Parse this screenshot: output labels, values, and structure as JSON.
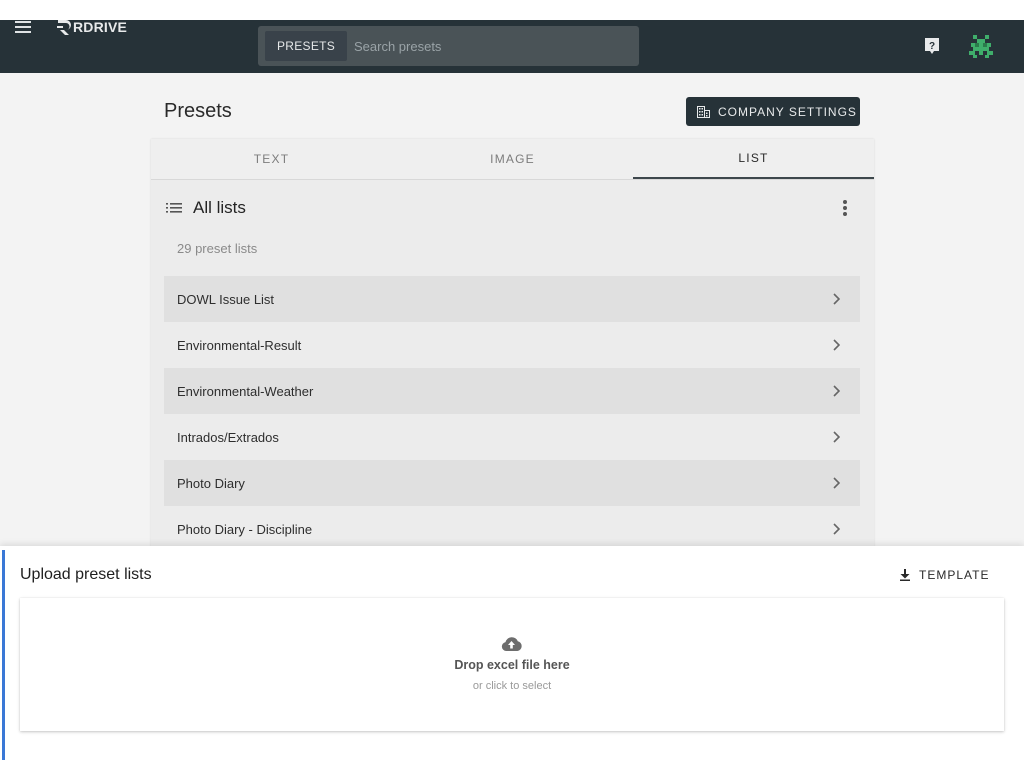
{
  "app": {
    "brand": "RDRIVE",
    "colors": {
      "appbar": "#263238",
      "accent_bar": "#3a78d6",
      "avatar": "#3fae6b"
    }
  },
  "header": {
    "menu_icon": "hamburger-menu-icon",
    "search": {
      "chip_label": "PRESETS",
      "placeholder": "Search presets"
    },
    "help_icon": "help-icon",
    "avatar_icon": "pixel-avatar-icon"
  },
  "page": {
    "title": "Presets",
    "company_settings_label": "COMPANY SETTINGS",
    "company_settings_icon": "building-icon"
  },
  "tabs": [
    {
      "label": "TEXT",
      "active": false
    },
    {
      "label": "IMAGE",
      "active": false
    },
    {
      "label": "LIST",
      "active": true
    }
  ],
  "lists": {
    "title": "All lists",
    "title_icon": "list-icon",
    "menu_icon": "more-vert-icon",
    "count_text": "29 preset lists",
    "items": [
      {
        "label": "DOWL Issue List"
      },
      {
        "label": "Environmental-Result"
      },
      {
        "label": "Environmental-Weather"
      },
      {
        "label": "Intrados/Extrados"
      },
      {
        "label": "Photo Diary"
      },
      {
        "label": "Photo Diary - Discipline"
      }
    ]
  },
  "upload": {
    "title": "Upload preset lists",
    "template_label": "TEMPLATE",
    "template_icon": "download-icon",
    "drop_icon": "cloud-upload-icon",
    "drop_main": "Drop excel file here",
    "drop_sub": "or click to select"
  }
}
